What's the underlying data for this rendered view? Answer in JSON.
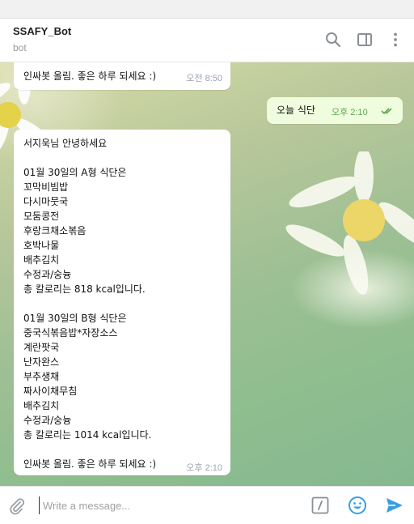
{
  "header": {
    "title": "SSAFY_Bot",
    "subtitle": "bot"
  },
  "messages": [
    {
      "direction": "in",
      "text": "인싸봇 올림. 좋은 하루 되세요 :)",
      "time": "오전 8:50"
    },
    {
      "direction": "out",
      "text": "오늘 식단",
      "time": "오후 2:10",
      "status": "read-double-check-icon"
    },
    {
      "direction": "in",
      "lines": [
        "서지욱님 안녕하세요",
        "",
        "01월 30일의 A형 식단은",
        "꼬막비빔밥",
        "다시마뭇국",
        "모둠콩전",
        "후랑크채소볶음",
        "호박나물",
        "배추김치",
        "수정과/숭늉",
        "총 칼로리는 818 kcal입니다.",
        "",
        "01월 30일의 B형 식단은",
        "중국식볶음밥*자장소스",
        "계란팟국",
        "난자완스",
        "부추생채",
        "짜사이채무침",
        "배추김치",
        "수정과/숭늉",
        "총 칼로리는 1014 kcal입니다.",
        "",
        "인싸봇 올림. 좋은 하루 되세요 :)"
      ],
      "time": "오후 2:10"
    }
  ],
  "composer": {
    "placeholder": "Write a message..."
  },
  "icons": {
    "search": "search-icon",
    "sidebar": "sidebar-toggle-icon",
    "more": "more-vertical-icon",
    "attach": "paperclip-icon",
    "command": "bot-command-icon",
    "emoji": "emoji-icon",
    "send": "send-icon"
  },
  "colors": {
    "accent": "#3a9de0",
    "outgoing_bubble": "#effdde",
    "read_check": "#5ea753"
  }
}
